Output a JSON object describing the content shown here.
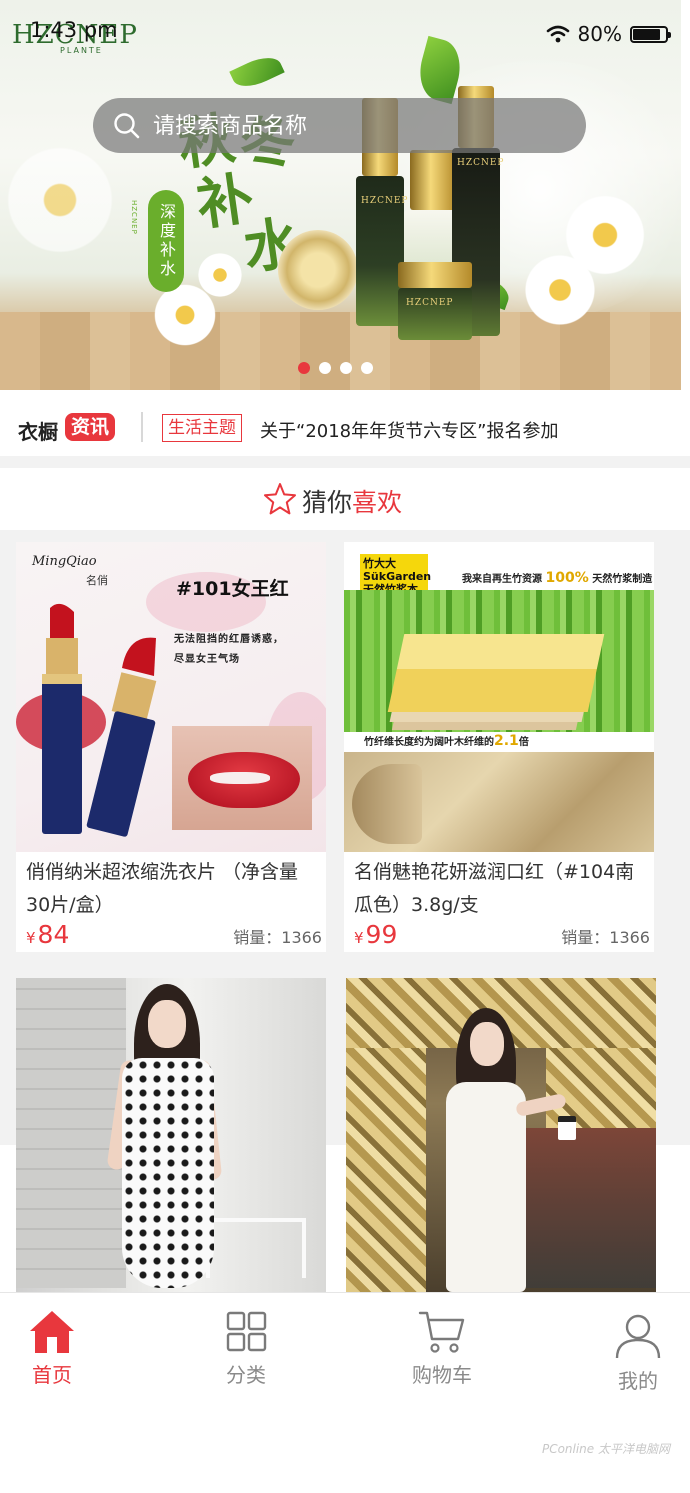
{
  "status_bar": {
    "time": "1:43 pm",
    "battery": "80%"
  },
  "banner": {
    "brand": "HZCNEP",
    "brand_sub": "PLANTE",
    "slogan_chars": [
      "秋",
      "冬",
      "补",
      "水"
    ],
    "tag": "深度补水",
    "tag_sub": "HZCNEP",
    "bottle_label": "HZCNEP",
    "slide_count": 4,
    "active_slide": 0
  },
  "search": {
    "placeholder": "请搜索商品名称"
  },
  "news": {
    "brand": "衣橱",
    "badge": "资讯",
    "tag": "生活主题",
    "text": "关于“2018年年货节六专区”报名参加"
  },
  "section": {
    "title_prefix": "猜你",
    "title_highlight": "喜欢"
  },
  "products": [
    {
      "title": "俏俏纳米超浓缩洗衣片 （净含量30片/盒）",
      "currency": "¥",
      "price": "84",
      "sales": "销量：1366",
      "image": {
        "brand": "MingQiao",
        "brand_cn": "名俏",
        "headline": "#101女王红",
        "line1": "无法阻挡的红唇诱惑，",
        "line2": "尽显女王气场"
      }
    },
    {
      "title": "名俏魅艳花妍滋润口红（#104南瓜色）3.8g/支",
      "currency": "¥",
      "price": "99",
      "sales": "销量：1366",
      "image": {
        "brand": "竹大大 SükGarden 天然竹浆本色纸",
        "headline_prefix": "我来自再生竹资源",
        "headline_highlight": "100%",
        "headline_suffix": "天然竹浆制造",
        "caption_prefix": "竹纤维长度约为阔叶木纤维的",
        "caption_highlight": "2.1",
        "caption_suffix": "倍"
      }
    },
    {
      "title": "",
      "price": "",
      "sales": ""
    },
    {
      "title": "",
      "price": "",
      "sales": ""
    }
  ],
  "tabbar": {
    "items": [
      {
        "label": "首页",
        "icon": "home-icon",
        "active": true
      },
      {
        "label": "分类",
        "icon": "grid-icon",
        "active": false
      },
      {
        "label": "购物车",
        "icon": "cart-icon",
        "active": false
      },
      {
        "label": "我的",
        "icon": "user-icon",
        "active": false
      }
    ]
  },
  "colors": {
    "accent": "#e8373d",
    "inactive": "#8a8a8a"
  },
  "watermark": "PConline 太平洋电脑网"
}
